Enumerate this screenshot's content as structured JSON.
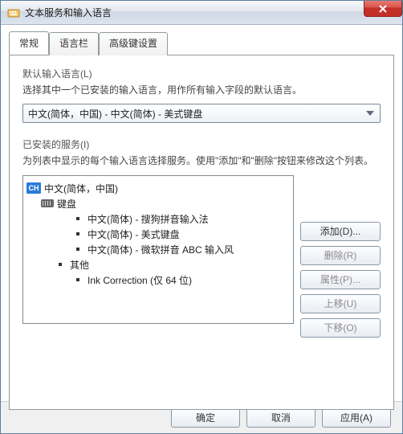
{
  "window": {
    "title": "文本服务和输入语言"
  },
  "tabs": {
    "general": "常规",
    "langbar": "语言栏",
    "advkeys": "高级键设置"
  },
  "defaultLang": {
    "heading": "默认输入语言(L)",
    "desc": "选择其中一个已安装的输入语言，用作所有输入字段的默认语言。",
    "selected": "中文(简体，中国) - 中文(简体) - 美式键盘"
  },
  "installed": {
    "heading": "已安装的服务(I)",
    "desc": "为列表中显示的每个输入语言选择服务。使用\"添加\"和\"删除\"按钮来修改这个列表。",
    "lang_badge": "CH",
    "lang_name": "中文(简体，中国)",
    "keyboard_label": "键盘",
    "kbd1": "中文(简体) - 搜狗拼音输入法",
    "kbd2": "中文(简体) - 美式键盘",
    "kbd3": "中文(简体) - 微软拼音 ABC 输入风",
    "other_label": "其他",
    "other1": "Ink Correction (仅 64 位)"
  },
  "buttons": {
    "add": "添加(D)...",
    "remove": "删除(R)",
    "properties": "属性(P)...",
    "moveup": "上移(U)",
    "movedown": "下移(O)",
    "ok": "确定",
    "cancel": "取消",
    "apply": "应用(A)"
  }
}
